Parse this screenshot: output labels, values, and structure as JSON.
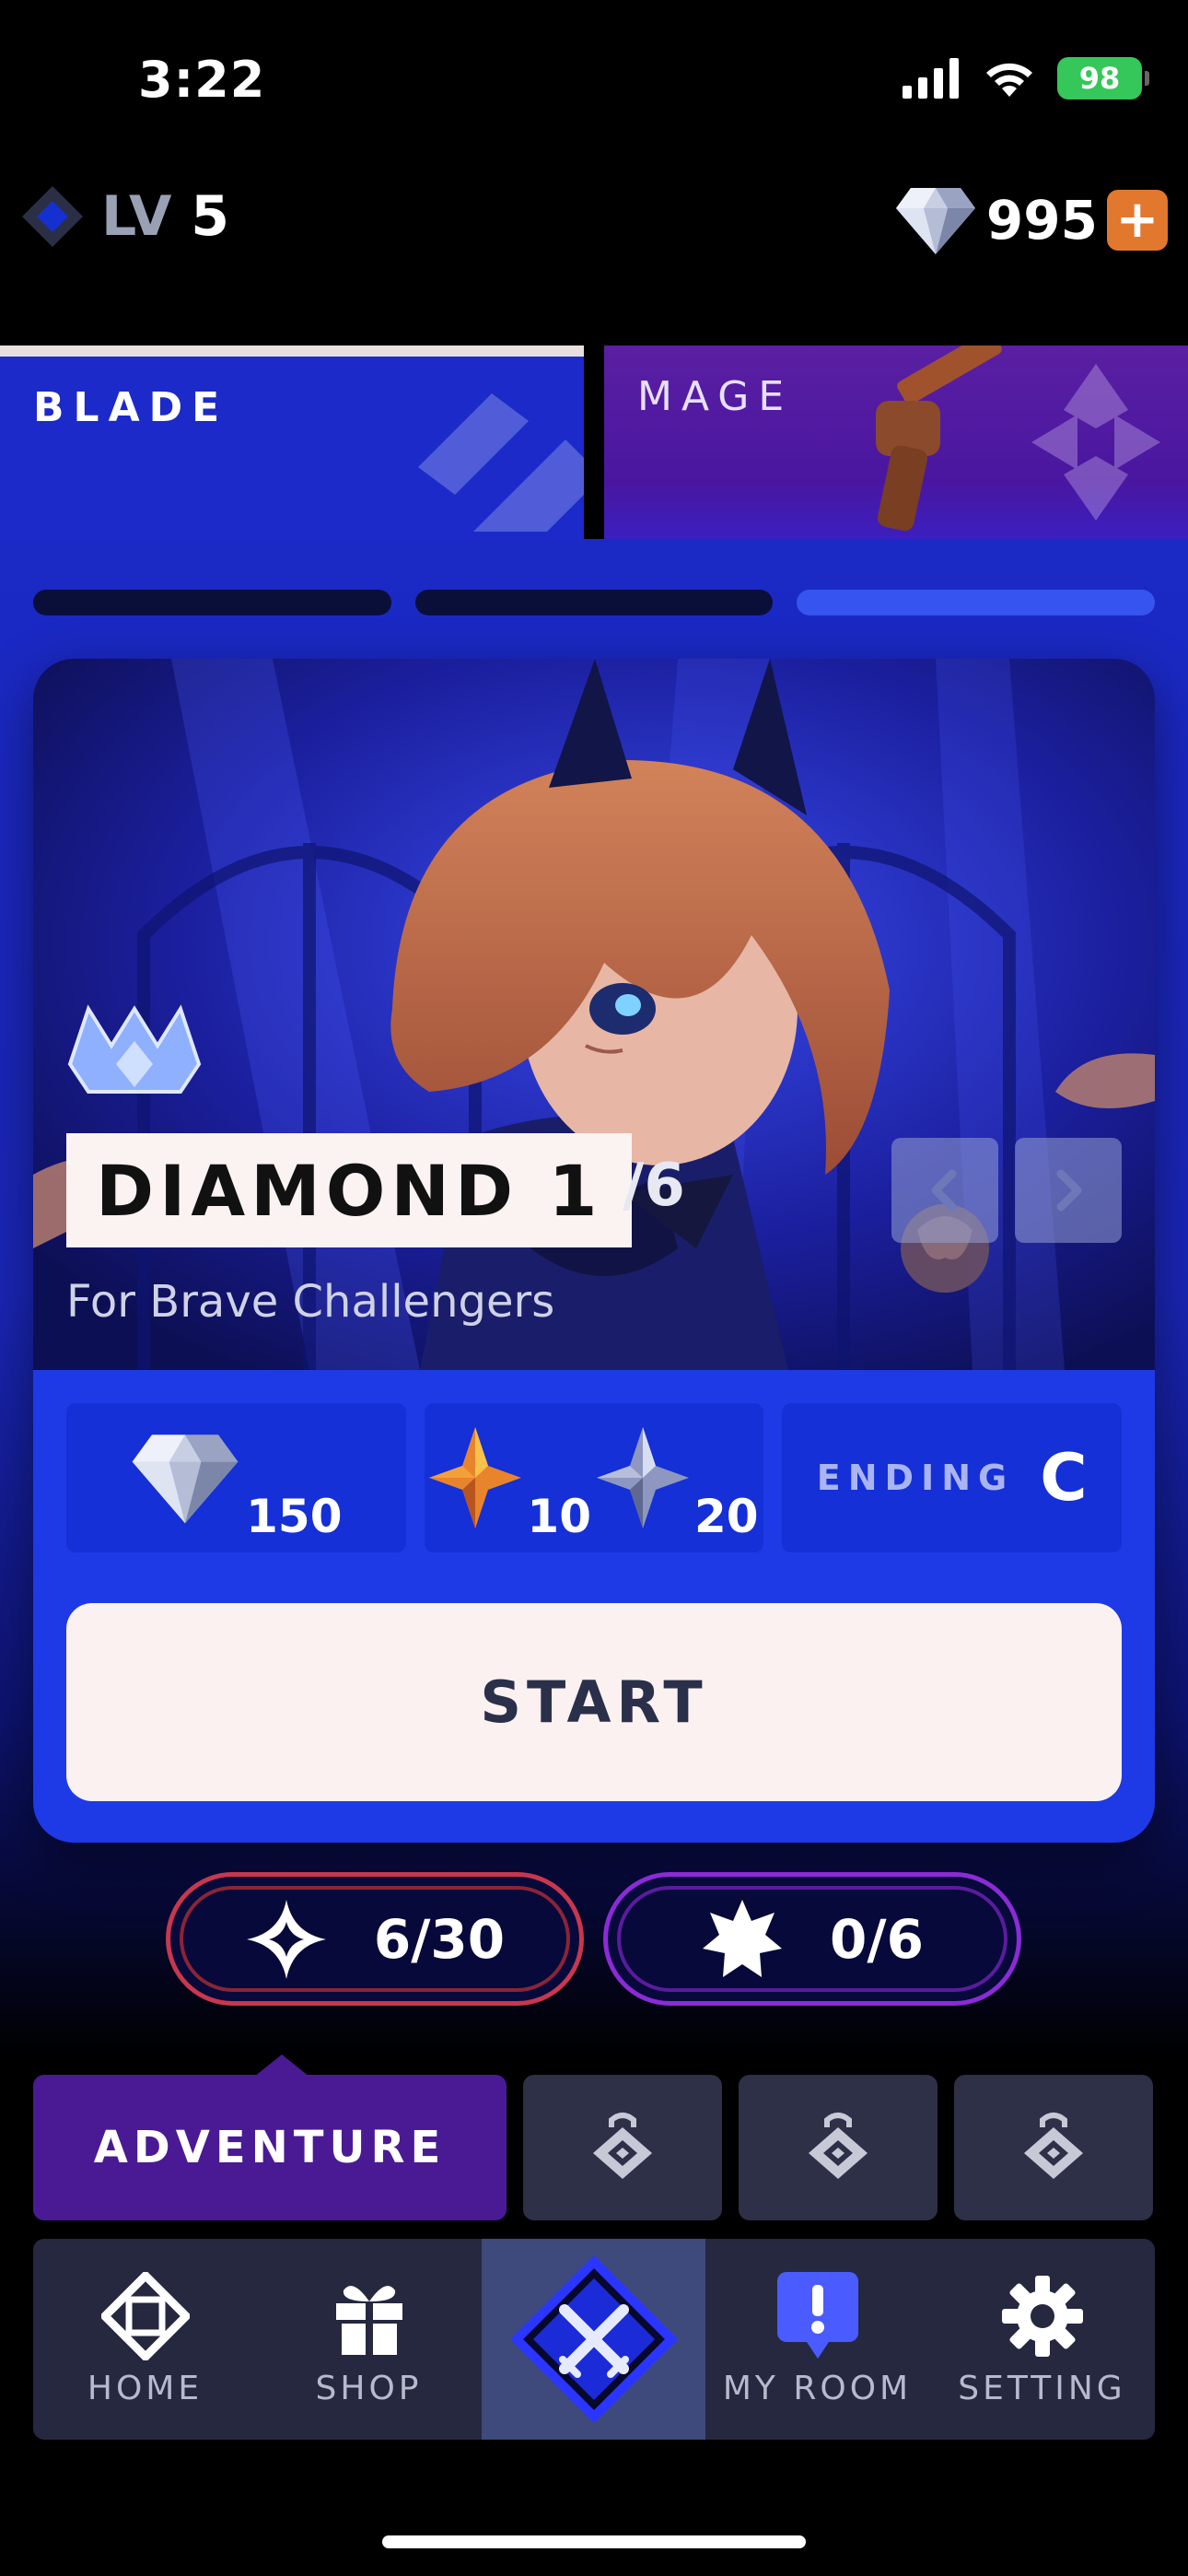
{
  "status": {
    "time": "3:22",
    "battery": "98"
  },
  "header": {
    "level_prefix": "LV",
    "level_value": "5",
    "gems": "995",
    "plus_label": "+"
  },
  "class_tabs": [
    {
      "label": "BLADE",
      "selected": true
    },
    {
      "label": "MAGE",
      "selected": false
    }
  ],
  "stage_progress": {
    "total": 3,
    "active_index": 2
  },
  "stage": {
    "title": "DIAMOND 1",
    "count": "/6",
    "subtitle": "For Brave Challengers"
  },
  "rewards": {
    "gem_reward": "150",
    "orange_star_reward": "10",
    "silver_star_reward": "20",
    "ending_label": "ENDING",
    "ending_grade": "C"
  },
  "start_label": "START",
  "counters": {
    "sparkle": "6/30",
    "burst": "0/6"
  },
  "mode_tabs": {
    "adventure_label": "ADVENTURE",
    "locked_count": 3
  },
  "bottom_nav": [
    {
      "label": "HOME",
      "icon": "home-diamond-icon"
    },
    {
      "label": "SHOP",
      "icon": "gift-icon"
    },
    {
      "label": "",
      "icon": "crossed-swords-icon",
      "selected": true
    },
    {
      "label": "MY ROOM",
      "icon": "alert-badge-icon"
    },
    {
      "label": "SETTING",
      "icon": "gear-icon"
    }
  ],
  "colors": {
    "background": "#000000",
    "main_blue": "#1b2ac9",
    "card_blue": "#1e3ae6",
    "mage_purple": "#4a16a0",
    "adventure_purple": "#4a1a94",
    "accent_orange": "#e2772e",
    "counter_red": "#c8374e",
    "counter_purple": "#8b2bd6"
  }
}
